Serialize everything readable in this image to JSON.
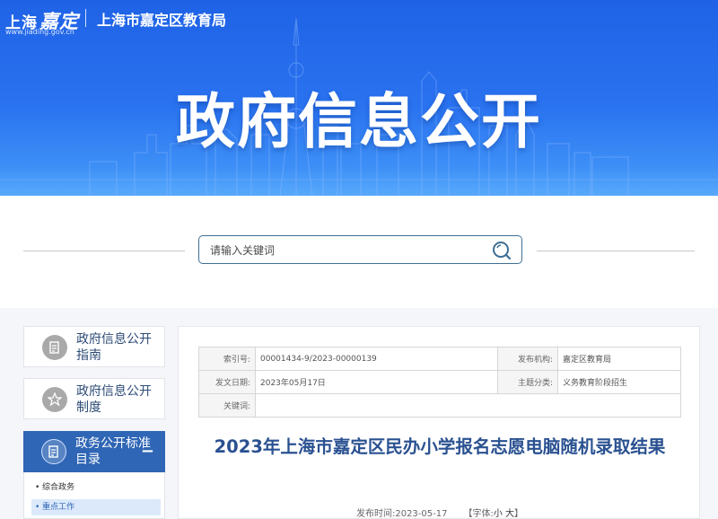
{
  "header": {
    "logo_text": "上海",
    "logo_script": "嘉定",
    "logo_url": "www.jiading.gov.cn",
    "dept_name": "上海市嘉定区教育局",
    "banner_title": "政府信息公开"
  },
  "search": {
    "placeholder": "请输入关键词",
    "icon": "search-icon"
  },
  "sidebar": {
    "items": [
      {
        "label": "政府信息公开指南",
        "icon": "document-icon"
      },
      {
        "label": "政府信息公开制度",
        "icon": "badge-icon"
      }
    ],
    "catalog": {
      "label": "政务公开标准目录",
      "icon": "document-icon",
      "toggle": "−",
      "sub_items": [
        {
          "label": "综合政务"
        },
        {
          "label": "重点工作"
        }
      ]
    }
  },
  "document": {
    "meta": {
      "index_label": "索引号:",
      "index_value": "00001434-9/2023-00000139",
      "publisher_label": "发布机构:",
      "publisher_value": "嘉定区教育局",
      "date_label": "发文日期:",
      "date_value": "2023年05月17日",
      "category_label": "主题分类:",
      "category_value": "义务教育阶段招生",
      "keywords_label": "关键词:",
      "keywords_value": ""
    },
    "title": "2023年上海市嘉定区民办小学报名志愿电脑随机录取结果",
    "publish_time_label": "发布时间:",
    "publish_time": "2023-05-17",
    "font_label": "【字体:",
    "font_small": "小",
    "font_large": "大",
    "font_close": "】"
  },
  "colors": {
    "banner": "#2a73f0",
    "accent": "#2f66b5",
    "title": "#2a5191"
  }
}
